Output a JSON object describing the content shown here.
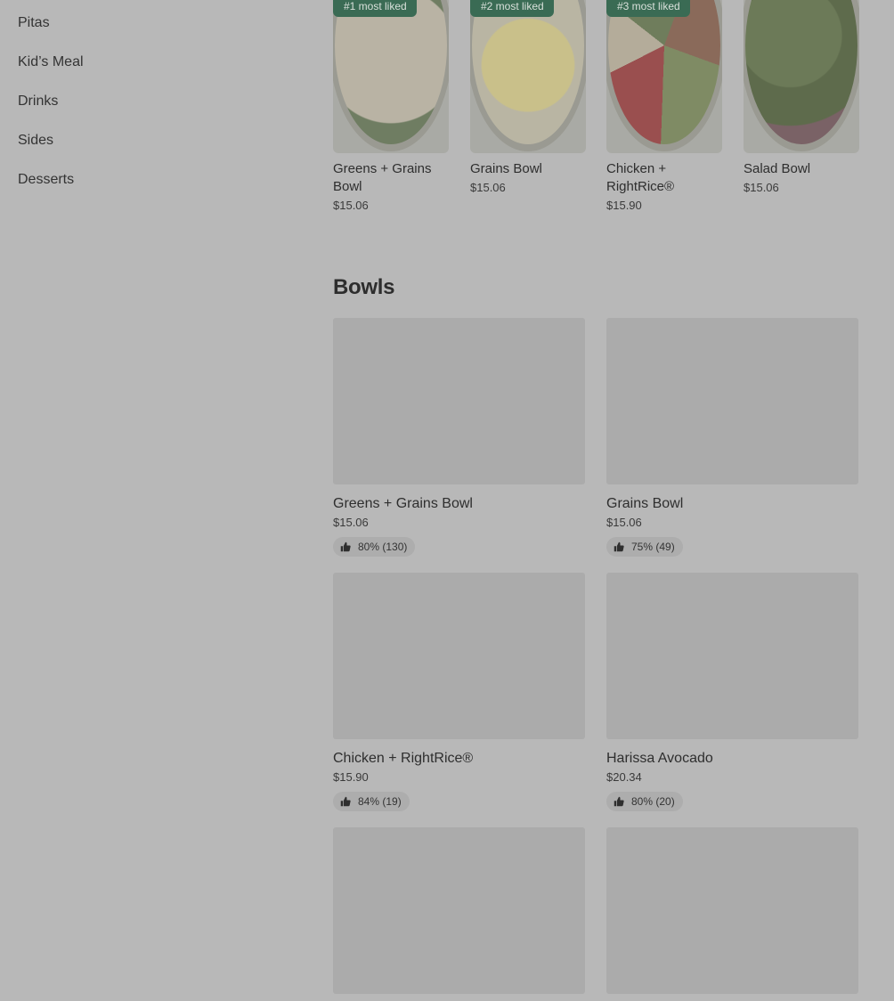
{
  "sidebar": {
    "items": [
      {
        "label": "Pitas"
      },
      {
        "label": "Kid’s Meal"
      },
      {
        "label": "Drinks"
      },
      {
        "label": "Sides"
      },
      {
        "label": "Desserts"
      }
    ]
  },
  "featured": {
    "items": [
      {
        "badge": "#1 most liked",
        "name": "Greens + Grains Bowl",
        "price": "$15.06",
        "icon": "food-photo-greens-grains"
      },
      {
        "badge": "#2 most liked",
        "name": "Grains Bowl",
        "price": "$15.06",
        "icon": "food-photo-grains"
      },
      {
        "badge": "#3 most liked",
        "name": "Chicken + RightRice®",
        "price": "$15.90",
        "icon": "food-photo-chicken-rightrice"
      },
      {
        "badge": "",
        "name": "Salad Bowl",
        "price": "$15.06",
        "icon": "food-photo-salad"
      }
    ]
  },
  "bowls": {
    "title": "Bowls",
    "items": [
      {
        "name": "Greens + Grains Bowl",
        "price": "$15.06",
        "rating": "80% (130)"
      },
      {
        "name": "Grains Bowl",
        "price": "$15.06",
        "rating": "75% (49)"
      },
      {
        "name": "Chicken + RightRice®",
        "price": "$15.90",
        "rating": "84% (19)"
      },
      {
        "name": "Harissa Avocado",
        "price": "$20.34",
        "rating": "80% (20)"
      },
      {
        "name": "",
        "price": "",
        "rating": ""
      },
      {
        "name": "",
        "price": "",
        "rating": ""
      }
    ]
  },
  "colors": {
    "overlay_background": "#b8b8b8",
    "badge_green": "#3a6b54",
    "placeholder_gray": "#ababab"
  }
}
